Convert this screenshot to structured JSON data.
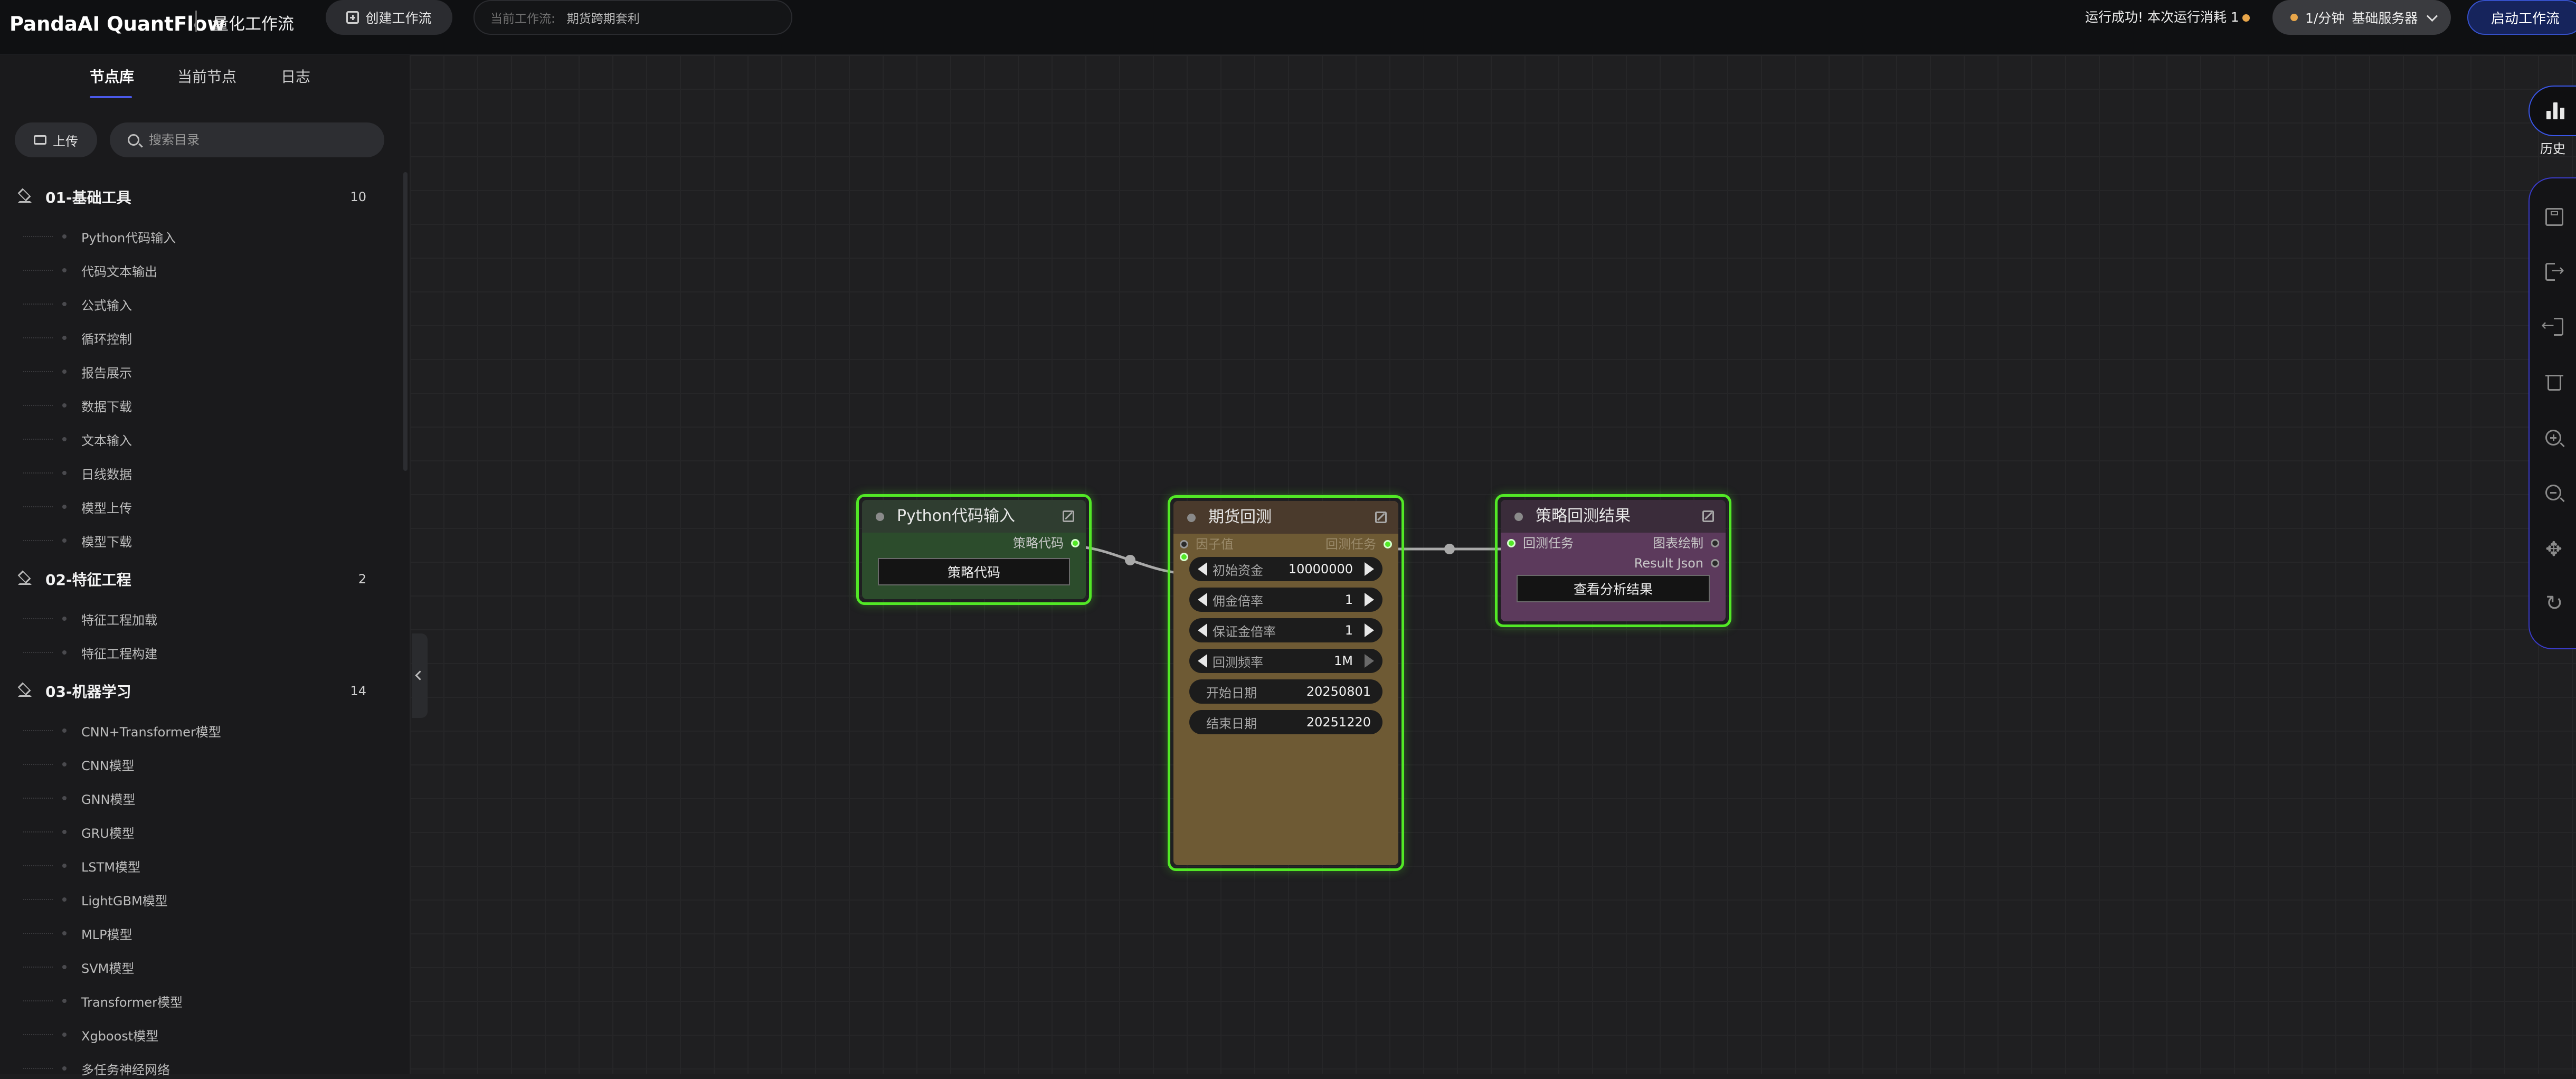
{
  "header": {
    "brand": "PandaAI QuantFlow",
    "subtitle": "量化工作流",
    "create_button": "创建工作流",
    "current_workflow_label": "当前工作流:",
    "current_workflow_value": "期货跨期套利",
    "run_status": "运行成功! 本次运行消耗 1",
    "server_rate": "1/分钟",
    "server_name": "基础服务器",
    "start_button": "启动工作流"
  },
  "sidebar": {
    "tabs": [
      "节点库",
      "当前节点",
      "日志"
    ],
    "active_tab": "节点库",
    "upload_button": "上传",
    "search_placeholder": "搜索目录",
    "categories": [
      {
        "name": "01-基础工具",
        "count": "10",
        "items": [
          "Python代码输入",
          "代码文本输出",
          "公式输入",
          "循环控制",
          "报告展示",
          "数据下载",
          "文本输入",
          "日线数据",
          "模型上传",
          "模型下载"
        ]
      },
      {
        "name": "02-特征工程",
        "count": "2",
        "items": [
          "特征工程加载",
          "特征工程构建"
        ]
      },
      {
        "name": "03-机器学习",
        "count": "14",
        "items": [
          "CNN+Transformer模型",
          "CNN模型",
          "GNN模型",
          "GRU模型",
          "LSTM模型",
          "LightGBM模型",
          "MLP模型",
          "SVM模型",
          "Transformer模型",
          "Xgboost模型",
          "多任务神经网络"
        ]
      }
    ]
  },
  "nodes": {
    "python_input": {
      "title": "Python代码输入",
      "output_port": "策略代码",
      "button": "策略代码"
    },
    "futures_backtest": {
      "title": "期货回测",
      "input_port": "因子值",
      "output_port": "回测任务",
      "widgets": [
        {
          "label": "初始资金",
          "value": "10000000"
        },
        {
          "label": "佣金倍率",
          "value": "1"
        },
        {
          "label": "保证金倍率",
          "value": "1"
        },
        {
          "label": "回测频率",
          "value": "1M"
        },
        {
          "label": "开始日期",
          "value": "20250801"
        },
        {
          "label": "结束日期",
          "value": "20251220"
        }
      ]
    },
    "backtest_result": {
      "title": "策略回测结果",
      "input_port": "回测任务",
      "output_ports": [
        "图表绘制",
        "Result Json"
      ],
      "button": "查看分析结果"
    }
  },
  "right_rail": {
    "history_label": "历史",
    "tools": [
      "save-icon",
      "export-icon",
      "import-icon",
      "trash-icon",
      "zoom-in-icon",
      "zoom-out-icon",
      "move-icon",
      "refresh-icon"
    ]
  },
  "colors": {
    "accent": "#3550c9",
    "node_selected_border": "#52e826",
    "python_node_bg": "#2c4c2c",
    "backtest_node_bg": "#6e5a34",
    "result_node_bg": "#5c3a5c",
    "coin": "#e8a64a"
  }
}
